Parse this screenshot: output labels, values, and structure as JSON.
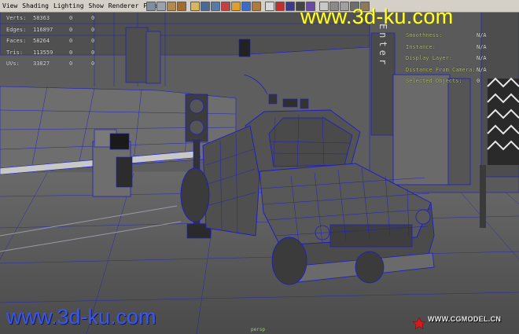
{
  "menubar": {
    "items": [
      "View",
      "Shading",
      "Lighting",
      "Show",
      "Renderer",
      "Panels"
    ]
  },
  "toolbar": {
    "icons": [
      "camera-select-icon",
      "camera-attributes-icon",
      "bookmark-icon",
      "image-plane-icon",
      "grid-icon",
      "film-gate-icon",
      "resolution-gate-icon",
      "gate-mask-icon",
      "field-chart-icon",
      "safe-action-icon",
      "safe-title-icon",
      "wireframe-icon",
      "smooth-shade-icon",
      "textured-icon",
      "lights-icon",
      "shadows-icon",
      "xray-icon",
      "isolate-select-icon",
      "hud-icon",
      "snapshot-icon",
      "playblast-icon"
    ]
  },
  "hud_left": [
    {
      "label": "Verts:",
      "value": "58363",
      "a": "0",
      "b": "0"
    },
    {
      "label": "Edges:",
      "value": "116897",
      "a": "0",
      "b": "0"
    },
    {
      "label": "Faces:",
      "value": "58264",
      "a": "0",
      "b": "0"
    },
    {
      "label": "Tris:",
      "value": "113559",
      "a": "0",
      "b": "0"
    },
    {
      "label": "UVs:",
      "value": "33827",
      "a": "0",
      "b": "0"
    }
  ],
  "hud_right": [
    {
      "label": "Smoothness:",
      "value": "N/A"
    },
    {
      "label": "Instance:",
      "value": "N/A"
    },
    {
      "label": "Display Layer:",
      "value": "N/A"
    },
    {
      "label": "Distance From Camera:",
      "value": "N/A"
    },
    {
      "label": "Selected Objects:",
      "value": "0"
    }
  ],
  "scene": {
    "sign_text": "Enter"
  },
  "camera_label": "persp",
  "watermarks": {
    "top": "www.3d-ku.com",
    "bottom": "www.3d-ku.com",
    "cgmodel": "WWW.CGMODEL.CN"
  },
  "colors": {
    "wire": "#1c1cc8",
    "hud_label": "#e6e6e6",
    "hud_right_label": "#b9c07c",
    "watermark_top": "#ffff33",
    "watermark_bottom": "#3a57e8"
  }
}
